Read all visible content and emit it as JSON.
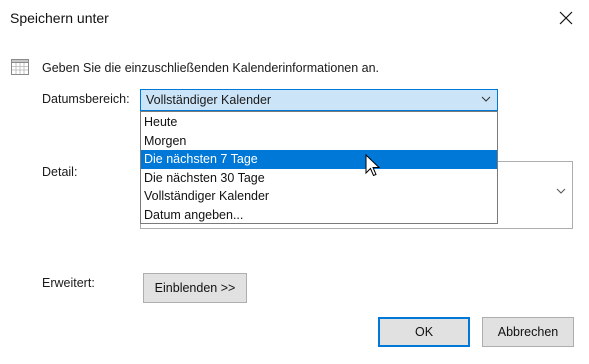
{
  "dialog": {
    "title": "Speichern unter",
    "close_symbol": "×",
    "intro_text": "Geben Sie die einzuschließenden Kalenderinformationen an."
  },
  "date_range": {
    "label": "Datumsbereich:",
    "selected_value": "Vollständiger Kalender",
    "options": [
      "Heute",
      "Morgen",
      "Die nächsten 7 Tage",
      "Die nächsten 30 Tage",
      "Vollständiger Kalender",
      "Datum angeben..."
    ],
    "highlighted_option": "Die nächsten 7 Tage"
  },
  "detail": {
    "label": "Detail:"
  },
  "advanced": {
    "label": "Erweitert:",
    "show_button": "Einblenden >>"
  },
  "buttons": {
    "ok": "OK",
    "cancel": "Abbrechen"
  },
  "icons": {
    "calendar": "calendar-icon",
    "close": "close-icon",
    "chevron": "chevron-down-icon",
    "cursor": "mouse-cursor-icon"
  },
  "colors": {
    "accent": "#0078d7",
    "combo_fill": "#cce4f7",
    "button_fill": "#e1e1e1"
  }
}
